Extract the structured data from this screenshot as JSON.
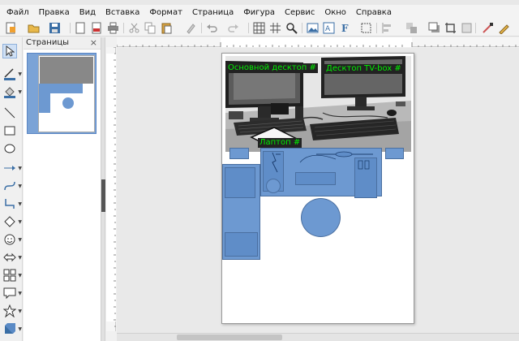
{
  "menu": [
    "Файл",
    "Правка",
    "Вид",
    "Вставка",
    "Формат",
    "Страница",
    "Фигура",
    "Сервис",
    "Окно",
    "Справка"
  ],
  "toolbar_icons": [
    "new-document-icon",
    "open-folder-icon",
    "save-icon",
    "export-icon",
    "pdf-icon",
    "print-icon",
    "cut-icon",
    "copy-icon",
    "paste-icon",
    "clone-formatting-icon",
    "undo-icon",
    "redo-icon",
    "grid-icon",
    "helplines-icon",
    "zoom-icon",
    "image-icon",
    "textbox-icon",
    "fontwork-icon",
    "transform-icon",
    "align-icon",
    "arrange-icon",
    "shadow-icon",
    "crop-icon",
    "filter-icon",
    "points-icon",
    "glue-points-icon"
  ],
  "drawbar_icons": [
    "select-icon",
    "line-color-icon",
    "fill-color-icon",
    "line-icon",
    "rectangle-icon",
    "ellipse-icon",
    "arrow-line-icon",
    "curve-icon",
    "connector-icon",
    "basic-shapes-icon",
    "symbol-shapes-icon",
    "block-arrows-icon",
    "flowchart-icon",
    "callout-icon",
    "stars-icon",
    "3d-objects-icon"
  ],
  "pages_panel": {
    "title": "Страницы",
    "close": "×"
  },
  "drawing": {
    "labels": {
      "main_desktop": "Основной десктоп #",
      "tvbox": "Десктоп TV-box #",
      "laptop": "Лаптоп #"
    }
  },
  "colors": {
    "shape_fill": "#6d99d1",
    "label_text": "#00ee00",
    "label_bg": "#222222"
  }
}
